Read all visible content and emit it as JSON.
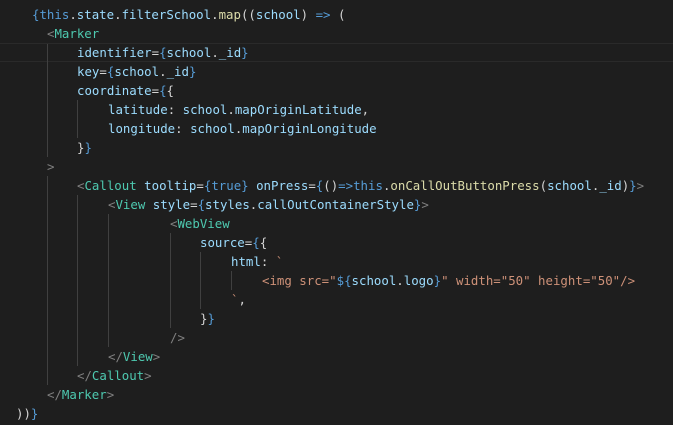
{
  "editor": {
    "colors": {
      "background": "#1e1e1e",
      "keyword": "#569cd6",
      "function": "#dcdcaa",
      "variable": "#9cdcfe",
      "tag": "#4ec9b0",
      "string": "#ce9178",
      "punctuation": "#d4d4d4",
      "tag_bracket": "#808080"
    },
    "lines": [
      [
        [
          "brace",
          "{"
        ],
        [
          "kw",
          "this"
        ],
        [
          "punc",
          "."
        ],
        [
          "var",
          "state"
        ],
        [
          "punc",
          "."
        ],
        [
          "var",
          "filterSchool"
        ],
        [
          "punc",
          "."
        ],
        [
          "fn",
          "map"
        ],
        [
          "punc",
          "(("
        ],
        [
          "var",
          "school"
        ],
        [
          "punc",
          ") "
        ],
        [
          "kw",
          "=>"
        ],
        [
          "punc",
          " ("
        ]
      ],
      [
        [
          "tagb",
          "<"
        ],
        [
          "tag",
          "Marker"
        ]
      ],
      [
        [
          "attr",
          "identifier"
        ],
        [
          "op",
          "="
        ],
        [
          "brace",
          "{"
        ],
        [
          "var",
          "school"
        ],
        [
          "punc",
          "."
        ],
        [
          "var",
          "_id"
        ],
        [
          "brace",
          "}"
        ]
      ],
      [
        [
          "attr",
          "key"
        ],
        [
          "op",
          "="
        ],
        [
          "brace",
          "{"
        ],
        [
          "var",
          "school"
        ],
        [
          "punc",
          "."
        ],
        [
          "var",
          "_id"
        ],
        [
          "brace",
          "}"
        ]
      ],
      [
        [
          "attr",
          "coordinate"
        ],
        [
          "op",
          "="
        ],
        [
          "brace",
          "{"
        ],
        [
          "punc",
          "{"
        ]
      ],
      [
        [
          "prop",
          "latitude"
        ],
        [
          "punc",
          ": "
        ],
        [
          "var",
          "school"
        ],
        [
          "punc",
          "."
        ],
        [
          "var",
          "mapOriginLatitude"
        ],
        [
          "punc",
          ","
        ]
      ],
      [
        [
          "prop",
          "longitude"
        ],
        [
          "punc",
          ": "
        ],
        [
          "var",
          "school"
        ],
        [
          "punc",
          "."
        ],
        [
          "var",
          "mapOriginLongitude"
        ]
      ],
      [
        [
          "punc",
          "}"
        ],
        [
          "brace",
          "}"
        ]
      ],
      [
        [
          "tagb",
          ">"
        ]
      ],
      [
        [
          "tagb",
          "<"
        ],
        [
          "tag",
          "Callout"
        ],
        [
          "punc",
          " "
        ],
        [
          "attr",
          "tooltip"
        ],
        [
          "op",
          "="
        ],
        [
          "brace",
          "{"
        ],
        [
          "kw",
          "true"
        ],
        [
          "brace",
          "}"
        ],
        [
          "punc",
          " "
        ],
        [
          "attr",
          "onPress"
        ],
        [
          "op",
          "="
        ],
        [
          "brace",
          "{"
        ],
        [
          "punc",
          "()"
        ],
        [
          "kw",
          "=>"
        ],
        [
          "kw",
          "this"
        ],
        [
          "punc",
          "."
        ],
        [
          "fn",
          "onCallOutButtonPress"
        ],
        [
          "punc",
          "("
        ],
        [
          "var",
          "school"
        ],
        [
          "punc",
          "."
        ],
        [
          "var",
          "_id"
        ],
        [
          "punc",
          ")"
        ],
        [
          "brace",
          "}"
        ],
        [
          "tagb",
          ">"
        ]
      ],
      [
        [
          "tagb",
          "<"
        ],
        [
          "tag",
          "View"
        ],
        [
          "punc",
          " "
        ],
        [
          "attr",
          "style"
        ],
        [
          "op",
          "="
        ],
        [
          "brace",
          "{"
        ],
        [
          "var",
          "styles"
        ],
        [
          "punc",
          "."
        ],
        [
          "var",
          "callOutContainerStyle"
        ],
        [
          "brace",
          "}"
        ],
        [
          "tagb",
          ">"
        ]
      ],
      [
        [
          "tagb",
          "<"
        ],
        [
          "tag",
          "WebView"
        ]
      ],
      [
        [
          "attr",
          "source"
        ],
        [
          "op",
          "="
        ],
        [
          "brace",
          "{"
        ],
        [
          "punc",
          "{"
        ]
      ],
      [
        [
          "prop",
          "html"
        ],
        [
          "punc",
          ": "
        ],
        [
          "str",
          "`"
        ]
      ],
      [
        [
          "str",
          "<img src=\""
        ],
        [
          "brace",
          "${"
        ],
        [
          "var",
          "school"
        ],
        [
          "punc",
          "."
        ],
        [
          "var",
          "logo"
        ],
        [
          "brace",
          "}"
        ],
        [
          "str",
          "\" width=\"50\" height=\"50\"/>"
        ]
      ],
      [
        [
          "str",
          "`"
        ],
        [
          "punc",
          ","
        ]
      ],
      [
        [
          "punc",
          "}"
        ],
        [
          "brace",
          "}"
        ]
      ],
      [
        [
          "tagb",
          "/>"
        ]
      ],
      [
        [
          "tagb",
          "</"
        ],
        [
          "tag",
          "View"
        ],
        [
          "tagb",
          ">"
        ]
      ],
      [
        [
          "tagb",
          "</"
        ],
        [
          "tag",
          "Callout"
        ],
        [
          "tagb",
          ">"
        ]
      ],
      [
        [
          "tagb",
          "</"
        ],
        [
          "tag",
          "Marker"
        ],
        [
          "tagb",
          ">"
        ]
      ],
      [
        [
          "punc",
          "))"
        ],
        [
          "brace",
          "}"
        ]
      ]
    ]
  }
}
